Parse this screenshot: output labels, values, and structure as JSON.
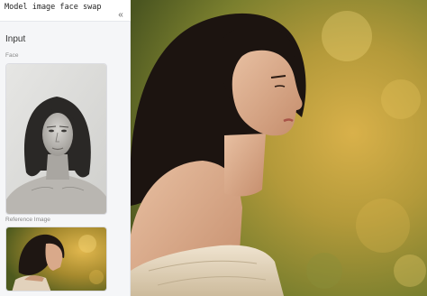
{
  "app": {
    "title": "Model image face swap"
  },
  "sidebar": {
    "collapse_icon": "chevrons-left-icon",
    "section_title": "Input",
    "face_label": "Face",
    "reference_label": "Reference Image"
  },
  "colors": {
    "sidebar_bg": "#f5f6f8",
    "main_bg_green": "#6f7a2c",
    "main_bg_gold": "#c9a03d"
  }
}
